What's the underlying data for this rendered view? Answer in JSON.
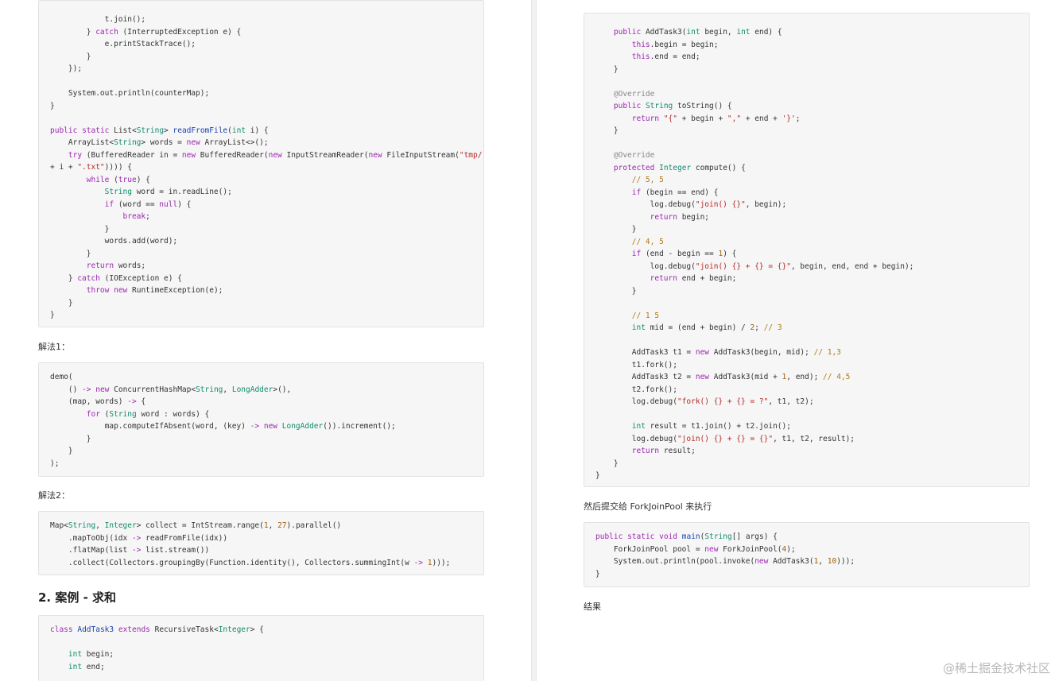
{
  "left": {
    "block1_lines": [
      "            t.join();",
      "        } catch (InterruptedException e) {",
      "            e.printStackTrace();",
      "        }",
      "    });",
      "",
      "    System.out.println(counterMap);",
      "}",
      "",
      "public static List<String> readFromFile(int i) {",
      "    ArrayList<String> words = new ArrayList<>();",
      "    try (BufferedReader in = new BufferedReader(new InputStreamReader(new FileInputStream(\"tmp/\"",
      "+ i + \".txt\")))) {",
      "        while (true) {",
      "            String word = in.readLine();",
      "            if (word == null) {",
      "                break;",
      "            }",
      "            words.add(word);",
      "        }",
      "        return words;",
      "    } catch (IOException e) {",
      "        throw new RuntimeException(e);",
      "    }",
      "}"
    ],
    "label1": "解法1：",
    "block2_lines": [
      "demo(",
      "    () -> new ConcurrentHashMap<String, LongAdder>(),",
      "    (map, words) -> {",
      "        for (String word : words) {",
      "            map.computeIfAbsent(word, (key) -> new LongAdder()).increment();",
      "        }",
      "    }",
      ");"
    ],
    "label2": "解法2：",
    "block3_lines": [
      "Map<String, Integer> collect = IntStream.range(1, 27).parallel()",
      "    .mapToObj(idx -> readFromFile(idx))",
      "    .flatMap(list -> list.stream())",
      "    .collect(Collectors.groupingBy(Function.identity(), Collectors.summingInt(w -> 1)));"
    ],
    "heading": "2. 案例 - 求和",
    "block4_lines": [
      "class AddTask3 extends RecursiveTask<Integer> {",
      "",
      "    int begin;",
      "    int end;"
    ]
  },
  "right": {
    "block1_lines": [
      "    public AddTask3(int begin, int end) {",
      "        this.begin = begin;",
      "        this.end = end;",
      "    }",
      "",
      "    @Override",
      "    public String toString() {",
      "        return \"{\" + begin + \",\" + end + '}';",
      "    }",
      "",
      "    @Override",
      "    protected Integer compute() {",
      "        // 5, 5",
      "        if (begin == end) {",
      "            log.debug(\"join() {}\", begin);",
      "            return begin;",
      "        }",
      "        // 4, 5",
      "        if (end - begin == 1) {",
      "            log.debug(\"join() {} + {} = {}\", begin, end, end + begin);",
      "            return end + begin;",
      "        }",
      "",
      "        // 1 5",
      "        int mid = (end + begin) / 2; // 3",
      "",
      "        AddTask3 t1 = new AddTask3(begin, mid); // 1,3",
      "        t1.fork();",
      "        AddTask3 t2 = new AddTask3(mid + 1, end); // 4,5",
      "        t2.fork();",
      "        log.debug(\"fork() {} + {} = ?\", t1, t2);",
      "",
      "        int result = t1.join() + t2.join();",
      "        log.debug(\"join() {} + {} = {}\", t1, t2, result);",
      "        return result;",
      "    }",
      "}"
    ],
    "label1": "然后提交给 ForkJoinPool 来执行",
    "block2_lines": [
      "public static void main(String[] args) {",
      "    ForkJoinPool pool = new ForkJoinPool(4);",
      "    System.out.println(pool.invoke(new AddTask3(1, 10)));",
      "}"
    ],
    "label2": "结果"
  },
  "watermark": "@稀土掘金技术社区"
}
